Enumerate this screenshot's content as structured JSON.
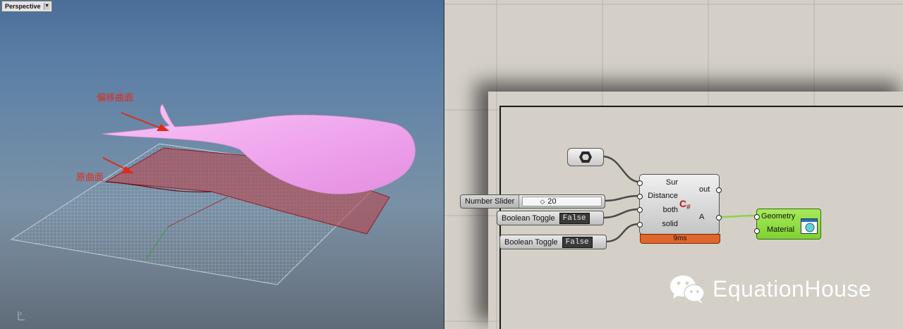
{
  "viewport": {
    "tab_label": "Perspective",
    "annotations": {
      "offset_surface": "偏移曲面",
      "original_surface": "原曲面"
    }
  },
  "grasshopper": {
    "number_slider": {
      "label": "Number Slider",
      "value": "20"
    },
    "toggles": [
      {
        "label": "Boolean Toggle",
        "state": "False"
      },
      {
        "label": "Boolean Toggle",
        "state": "False"
      }
    ],
    "csharp": {
      "inputs": [
        "Sur",
        "Distance",
        "both",
        "solid"
      ],
      "outputs": [
        "out",
        "A"
      ],
      "timing": "9ms"
    },
    "geometry_preview": {
      "inputs": [
        "Geometry",
        "Material"
      ]
    }
  },
  "watermark": {
    "text": "EquationHouse"
  },
  "colors": {
    "csharp_timing": "#e0662d",
    "preview_component": "#96e049",
    "offset_surface": "#f0a8ee",
    "original_surface": "#b84046"
  },
  "icons": [
    "hexagon-param-icon",
    "csharp-icon",
    "material-preview-icon",
    "wechat-icon",
    "world-axis-icon"
  ]
}
